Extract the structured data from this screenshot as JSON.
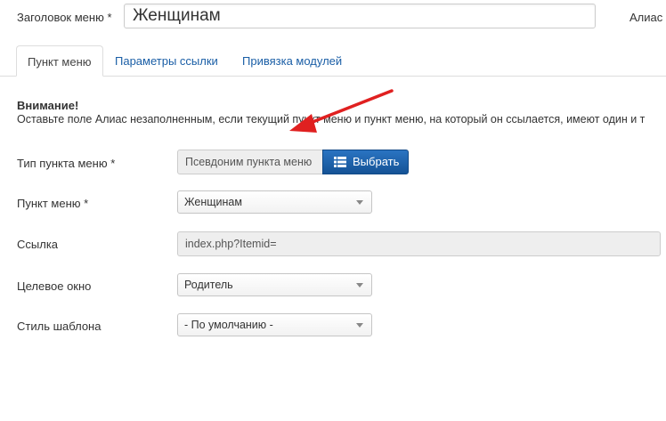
{
  "header": {
    "title_label": "Заголовок меню *",
    "title_value": "Женщинам",
    "alias_label": "Алиас"
  },
  "tabs": [
    {
      "label": "Пункт меню",
      "active": true
    },
    {
      "label": "Параметры ссылки",
      "active": false
    },
    {
      "label": "Привязка модулей",
      "active": false
    }
  ],
  "alert": {
    "title": "Внимание!",
    "text": "Оставьте поле Алиас незаполненным, если текущий пункт меню и пункт меню, на который он ссылается, имеют один и т"
  },
  "form": {
    "menu_item_type": {
      "label": "Тип пункта меню *",
      "value": "Псевдоним пункта меню",
      "button": "Выбрать"
    },
    "menu_item": {
      "label": "Пункт меню *",
      "value": "Женщинам"
    },
    "link": {
      "label": "Ссылка",
      "value": "index.php?Itemid="
    },
    "target_window": {
      "label": "Целевое окно",
      "value": "Родитель"
    },
    "template_style": {
      "label": "Стиль шаблона",
      "value": "- По умолчанию -"
    }
  },
  "colors": {
    "primary_button": "#1f63ad",
    "link": "#1a5ea6",
    "annotation_arrow": "#e02020"
  },
  "icons": {
    "choose_button": "list-icon",
    "select_caret": "caret-down-icon"
  }
}
